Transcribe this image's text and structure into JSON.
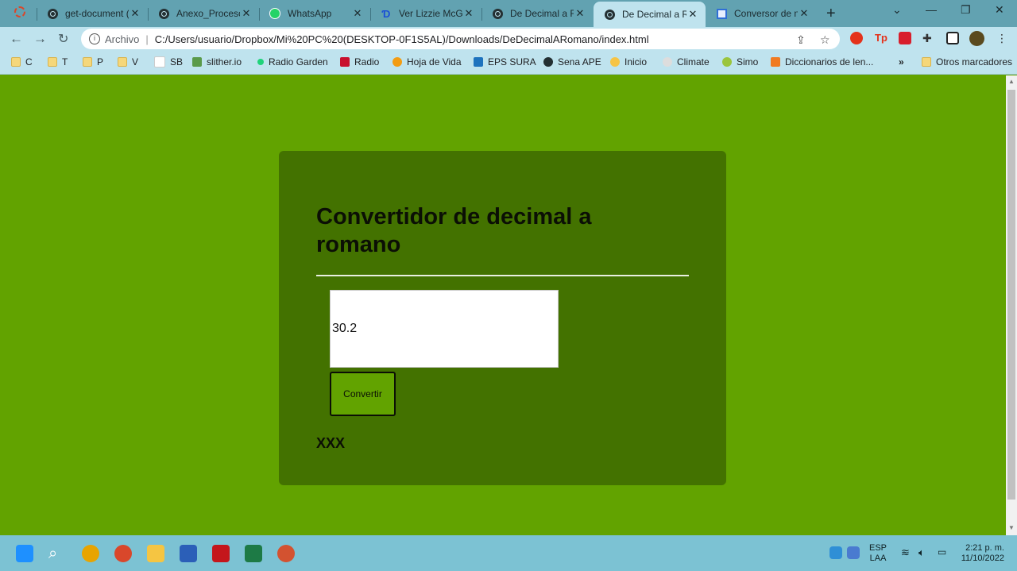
{
  "tabs": [
    {
      "title": "get-document (",
      "icon": "globe-icon"
    },
    {
      "title": "Anexo_Proceso",
      "icon": "globe-icon"
    },
    {
      "title": "WhatsApp",
      "icon": "whatsapp-icon"
    },
    {
      "title": "Ver Lizzie McGu",
      "icon": "streaming-icon"
    },
    {
      "title": "De Decimal a Rc",
      "icon": "globe-icon"
    },
    {
      "title": "De Decimal a Rc",
      "icon": "globe-icon",
      "active": true
    },
    {
      "title": "Conversor de nu",
      "icon": "grid-icon"
    }
  ],
  "omnibox": {
    "label": "Archivo",
    "url": "C:/Users/usuario/Dropbox/Mi%20PC%20(DESKTOP-0F1S5AL)/Downloads/DeDecimalARomano/index.html"
  },
  "bookmarks": [
    {
      "label": "C"
    },
    {
      "label": "T"
    },
    {
      "label": "P"
    },
    {
      "label": "V"
    },
    {
      "label": "SB"
    },
    {
      "label": "slither.io"
    },
    {
      "label": "Radio Garden"
    },
    {
      "label": "Radio"
    },
    {
      "label": "Hoja de Vida"
    },
    {
      "label": "EPS SURA"
    },
    {
      "label": "Sena APE"
    },
    {
      "label": "Inicio"
    },
    {
      "label": "Climate"
    },
    {
      "label": "Simo"
    },
    {
      "label": "Diccionarios de len..."
    }
  ],
  "bookmarks_overflow": "»",
  "other_bookmarks": "Otros marcadores",
  "page": {
    "title": "Convertidor de decimal a romano",
    "input_value": "30.2",
    "button_label": "Convertir",
    "result": "XXX"
  },
  "colors": {
    "page_bg": "#62a300",
    "card_bg": "#437200",
    "button_bg": "#62a300"
  },
  "taskbar": {
    "lang_top": "ESP",
    "lang_bottom": "LAA",
    "time": "2:21 p. m.",
    "date": "11/10/2022"
  }
}
